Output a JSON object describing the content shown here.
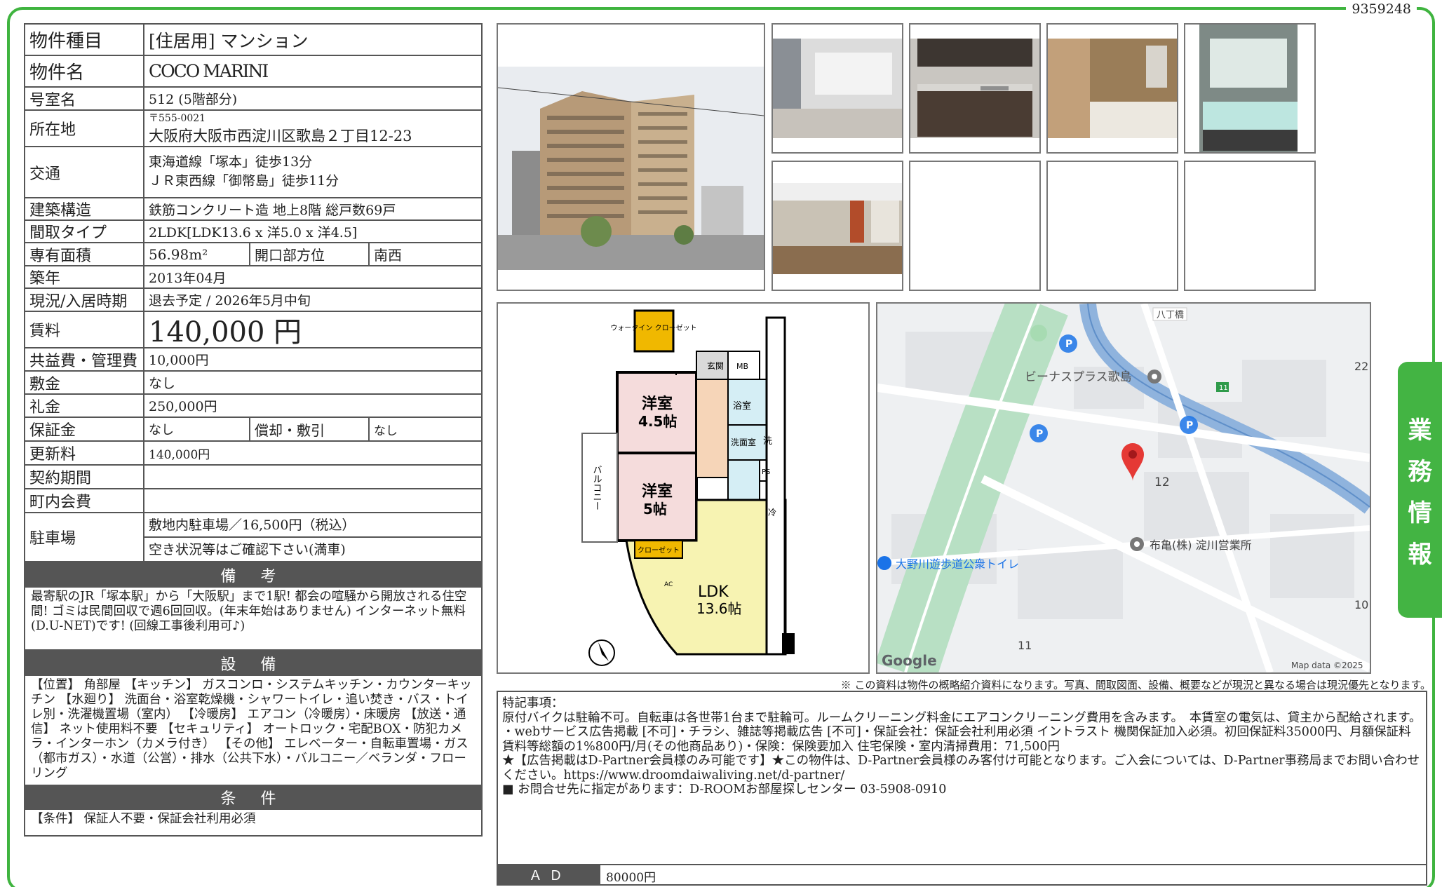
{
  "doc_id": "9359248",
  "side_tab": [
    "業",
    "務",
    "情",
    "報"
  ],
  "property": {
    "type_label": "物件種目",
    "type_value": "[住居用] マンション",
    "name_label": "物件名",
    "name_value": "COCO MARINI",
    "room_label": "号室名",
    "room_value": "512 (5階部分)",
    "address_label": "所在地",
    "postal": "〒555-0021",
    "address": "大阪府大阪市西淀川区歌島２丁目12-23",
    "transit_label": "交通",
    "transit_1": "東海道線「塚本」徒歩13分",
    "transit_2": "ＪＲ東西線「御幣島」徒歩11分",
    "structure_label": "建築構造",
    "structure_value": "鉄筋コンクリート造 地上8階 総戸数69戸",
    "layout_label": "間取タイプ",
    "layout_value": "2LDK[LDK13.6 x 洋5.0 x 洋4.5]",
    "area_label": "専有面積",
    "area_value": "56.98m²",
    "direction_label": "開口部方位",
    "direction_value": "南西",
    "built_label": "築年",
    "built_value": "2013年04月",
    "status_label": "現況/入居時期",
    "status_value": "退去予定 / 2026年5月中旬",
    "rent_label": "賃料",
    "rent_value": "140,000 円",
    "fee_label": "共益費・管理費",
    "fee_value": "10,000円",
    "deposit_label": "敷金",
    "deposit_value": "なし",
    "key_money_label": "礼金",
    "key_money_value": "250,000円",
    "guarantee_label": "保証金",
    "guarantee_value": "なし",
    "amort_label": "償却・敷引",
    "amort_value": "なし",
    "renewal_label": "更新料",
    "renewal_value": "140,000円",
    "contract_label": "契約期間",
    "contract_value": "",
    "town_label": "町内会費",
    "town_value": "",
    "parking_label": "駐車場",
    "parking_1": "敷地内駐車場／16,500円（税込）",
    "parking_2": "空き状況等はご確認下さい(満車)"
  },
  "sections": {
    "bikou_head": "備 考",
    "bikou_text": "最寄駅のJR「塚本駅」から「大阪駅」まで1駅! 都会の喧騒から開放される住空間! ゴミは民間回収で週6回回収。(年末年始はありません) インターネット無料(D.U-NET)です! (回線工事後利用可♪)",
    "setsubi_head": "設 備",
    "setsubi_text": "【位置】 角部屋 【キッチン】 ガスコンロ・システムキッチン・カウンターキッチン 【水廻り】 洗面台・浴室乾燥機・シャワートイレ・追い焚き・バス・トイレ別・洗濯機置場（室内） 【冷暖房】 エアコン（冷暖房）・床暖房 【放送・通信】 ネット使用料不要 【セキュリティ】 オートロック・宅配BOX・防犯カメラ・インターホン（カメラ付き） 【その他】 エレベーター・自転車置場・ガス（都市ガス）・水道（公営）・排水（公共下水）・バルコニー／ベランダ・フローリング",
    "jouken_head": "条 件",
    "jouken_text": "【条件】 保証人不要・保証会社利用必須"
  },
  "floorplan": {
    "rooms": [
      "ウォークイン クローゼット",
      "玄関",
      "MB",
      "洋室",
      "4.5帖",
      "浴室",
      "洗面室",
      "洗",
      "PS",
      "洋室",
      "5帖",
      "バルコニー",
      "冷",
      "クローゼット",
      "AC",
      "LDK",
      "13.6帖"
    ]
  },
  "map": {
    "labels": [
      "八丁橋",
      "ビーナスプラス歌島",
      "11",
      "12",
      "布亀(株) 淀川営業所",
      "大野川遊歩道公衆トイレ",
      "11",
      "10",
      "22"
    ],
    "attribution": "Map data ©2025",
    "logo": "Google"
  },
  "disclaimer": "※ この資料は物件の概略紹介資料になります。写真、間取図面、設備、概要などが現況と異なる場合は現況優先となります。",
  "remarks": {
    "title": "特記事項：",
    "line1": "原付バイクは駐輪不可。自転車は各世帯1台まで駐輪可。ルームクリーニング料金にエアコンクリーニング費用を含みます。　本賃室の電気は、貸主から配給されます。",
    "line2": "・webサービス広告掲載 [不可]・チラシ、雑誌等掲載広告 [不可]・保証会社：保証会社利用必須 イントラスト 機関保証加入必須。初回保証料35000円、月額保証料賃料等総額の1%800円/月(その他商品あり)・保険：保険要加入 住宅保険・室内清掃費用：71,500円",
    "line3": "★【広告掲載はD-Partner会員様のみ可能です】★この物件は、D-Partner会員様のみ客付け可能となります。ご入会については、D-Partner事務局までお問い合わせください。https://www.droomdaiwaliving.net/d-partner/",
    "line4": "■ お問合せ先に指定があります：D-ROOMお部屋探しセンター 03-5908-0910",
    "ad_label": "ＡＤ",
    "ad_value": "80000円"
  }
}
